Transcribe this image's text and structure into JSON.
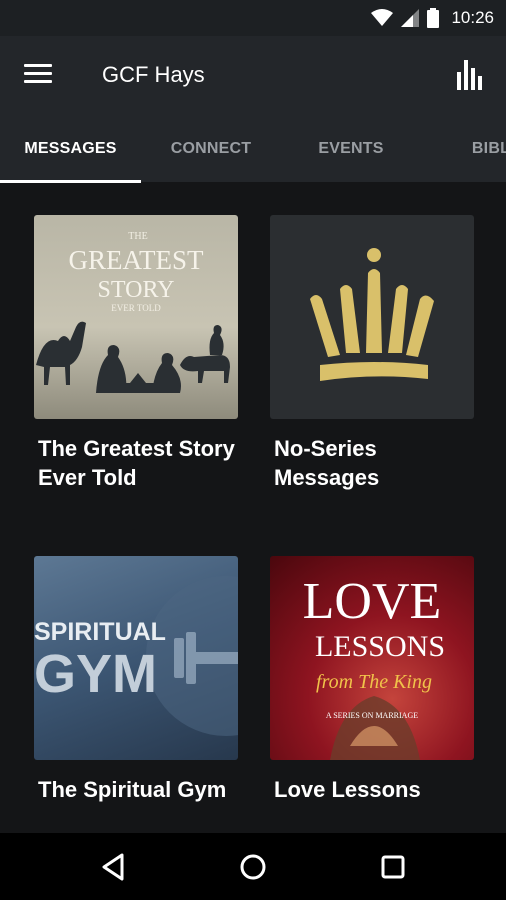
{
  "status": {
    "time": "10:26",
    "icons": [
      "wifi-icon",
      "signal-icon",
      "battery-icon"
    ]
  },
  "app_bar": {
    "title": "GCF Hays",
    "menu_icon": "hamburger-menu-icon",
    "chart_icon": "bar-chart-icon"
  },
  "tabs": [
    {
      "label": "MESSAGES",
      "active": true
    },
    {
      "label": "CONNECT"
    },
    {
      "label": "EVENTS"
    },
    {
      "label": "BIBL"
    }
  ],
  "series": [
    {
      "title": "The Greatest Story Ever Told",
      "art": {
        "line1": "THE",
        "line2": "GREATEST",
        "line3": "STORY",
        "line4": "EVER TOLD"
      }
    },
    {
      "title": "No-Series Messages",
      "art": {
        "icon": "crown-icon"
      }
    },
    {
      "title": "The Spiritual Gym",
      "art": {
        "line1": "SPIRITUAL",
        "line2": "GYM"
      }
    },
    {
      "title": "Love Lessons",
      "art": {
        "line1": "LOVE",
        "line2": "LESSONS",
        "line3": "from The King",
        "line4": "A SERIES ON MARRIAGE"
      }
    }
  ],
  "nav": {
    "back": "back-triangle-icon",
    "home": "home-circle-icon",
    "recents": "recents-square-icon"
  },
  "colors": {
    "background": "#141517",
    "app_bar": "#23262a",
    "crown_gold": "#d9c06a",
    "love_red": "#8e1420"
  }
}
